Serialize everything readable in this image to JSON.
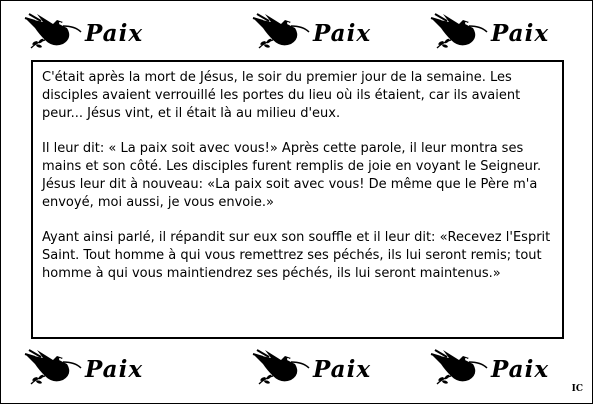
{
  "decorations": {
    "stamp_word": "Paix",
    "stamp_icon": "dove-with-olive-branch-icon",
    "stamp_count": 6
  },
  "text": {
    "paragraphs": [
      "C'était après la mort de Jésus, le soir du premier jour de la semaine. Les disciples avaient verrouillé les portes du lieu où ils étaient, car ils avaient peur... Jésus vint, et il était là au milieu d'eux.",
      "Il leur dit: « La paix soit avec vous!» Après cette parole, il leur montra ses mains et son côté. Les disciples furent remplis de joie en voyant le Seigneur. Jésus leur dit à nouveau: «La paix soit avec vous! De même que le Père m'a envoyé, moi aussi, je vous envoie.»",
      "Ayant ainsi parlé, il répandit sur eux son souffle et il leur dit: «Recevez l'Esprit Saint. Tout homme à qui vous remettrez ses péchés, ils lui seront remis; tout homme à qui vous maintiendrez ses péchés, ils lui seront maintenus.»"
    ]
  },
  "signature": "IC",
  "colors": {
    "ink": "#000000",
    "background": "#ffffff"
  }
}
